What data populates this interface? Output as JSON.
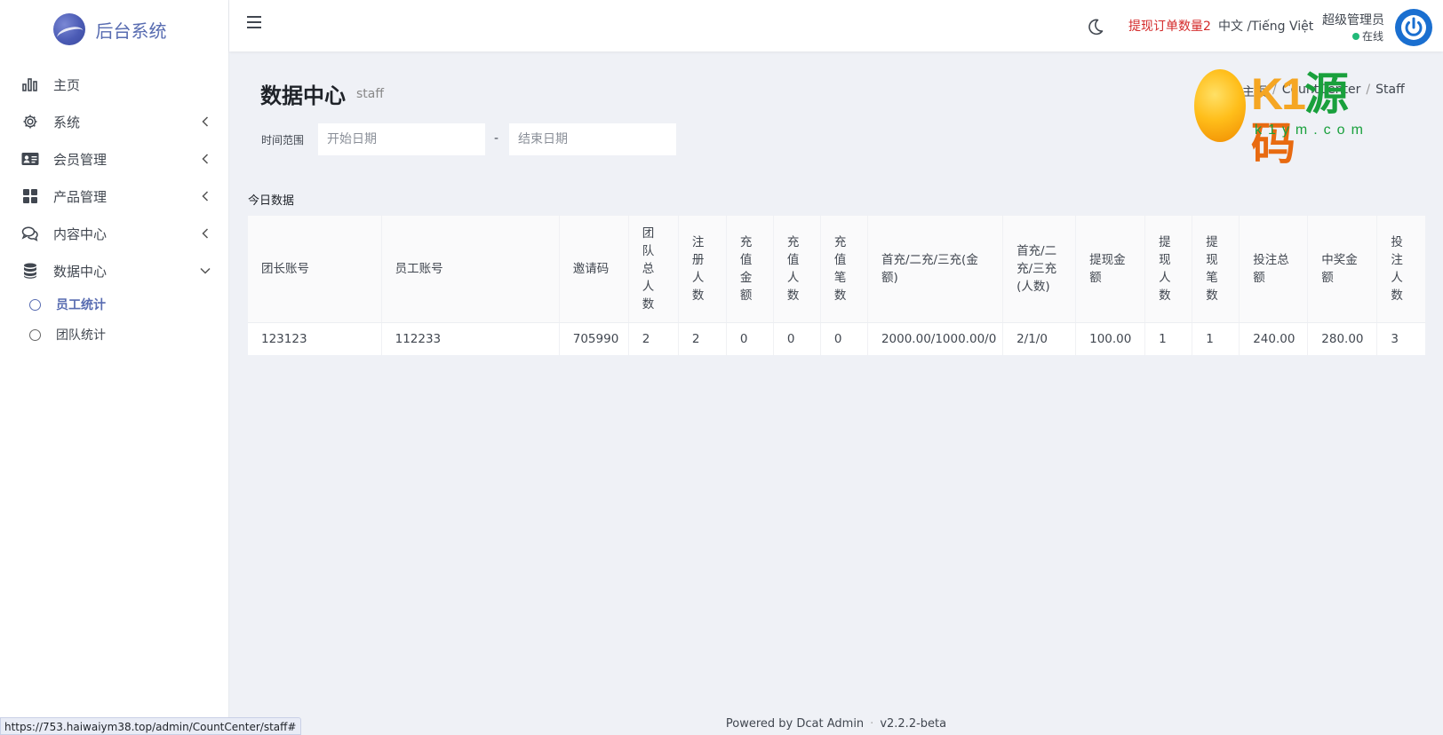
{
  "brand": {
    "name": "后台系统"
  },
  "sidebar": {
    "items": [
      {
        "label": "主页",
        "icon": "bar-chart-icon",
        "has_children": false
      },
      {
        "label": "系统",
        "icon": "gear-icon",
        "has_children": true,
        "expanded": false
      },
      {
        "label": "会员管理",
        "icon": "id-card-icon",
        "has_children": true,
        "expanded": false
      },
      {
        "label": "产品管理",
        "icon": "grid-icon",
        "has_children": true,
        "expanded": false
      },
      {
        "label": "内容中心",
        "icon": "comments-icon",
        "has_children": true,
        "expanded": false
      },
      {
        "label": "数据中心",
        "icon": "database-icon",
        "has_children": true,
        "expanded": true
      }
    ],
    "subitems": [
      {
        "label": "员工统计",
        "active": true
      },
      {
        "label": "团队统计",
        "active": false
      }
    ]
  },
  "topbar": {
    "withdraw_notice": "提现订单数量2",
    "language": "中文 /Tiếng Việt",
    "user_name": "超级管理员",
    "user_status": "在线"
  },
  "page": {
    "title": "数据中心",
    "subtitle": "staff",
    "breadcrumb": [
      "主页",
      "CountCenter",
      "Staff"
    ]
  },
  "filter": {
    "label": "时间范围",
    "start_placeholder": "开始日期",
    "end_placeholder": "结束日期",
    "separator": "-"
  },
  "watermark": {
    "brand_k": "K1",
    "brand_cn_1": "源",
    "brand_cn_2": "码",
    "url": "k1ym.com"
  },
  "section": {
    "title": "今日数据"
  },
  "table": {
    "headers": [
      "团长账号",
      "员工账号",
      "邀请码",
      "团队总人数",
      "注册人数",
      "充值金额",
      "充值人数",
      "充值笔数",
      "首充/二充/三充(金额)",
      "首充/二充/三充(人数)",
      "提现金额",
      "提现人数",
      "提现笔数",
      "投注总额",
      "中奖金额",
      "投注人数"
    ],
    "rows": [
      [
        "123123",
        "112233",
        "705990",
        "2",
        "2",
        "0",
        "0",
        "0",
        "2000.00/1000.00/0",
        "2/1/0",
        "100.00",
        "1",
        "1",
        "240.00",
        "280.00",
        "3"
      ]
    ]
  },
  "footer": {
    "powered": "Powered by Dcat Admin",
    "version": "v2.2.2-beta"
  },
  "statusbar": {
    "url": "https://753.haiwaiym38.top/admin/CountCenter/staff#"
  },
  "colors": {
    "accent": "#586cb1",
    "danger": "#d42a2a",
    "online": "#21b978",
    "background": "#eff1f6"
  }
}
